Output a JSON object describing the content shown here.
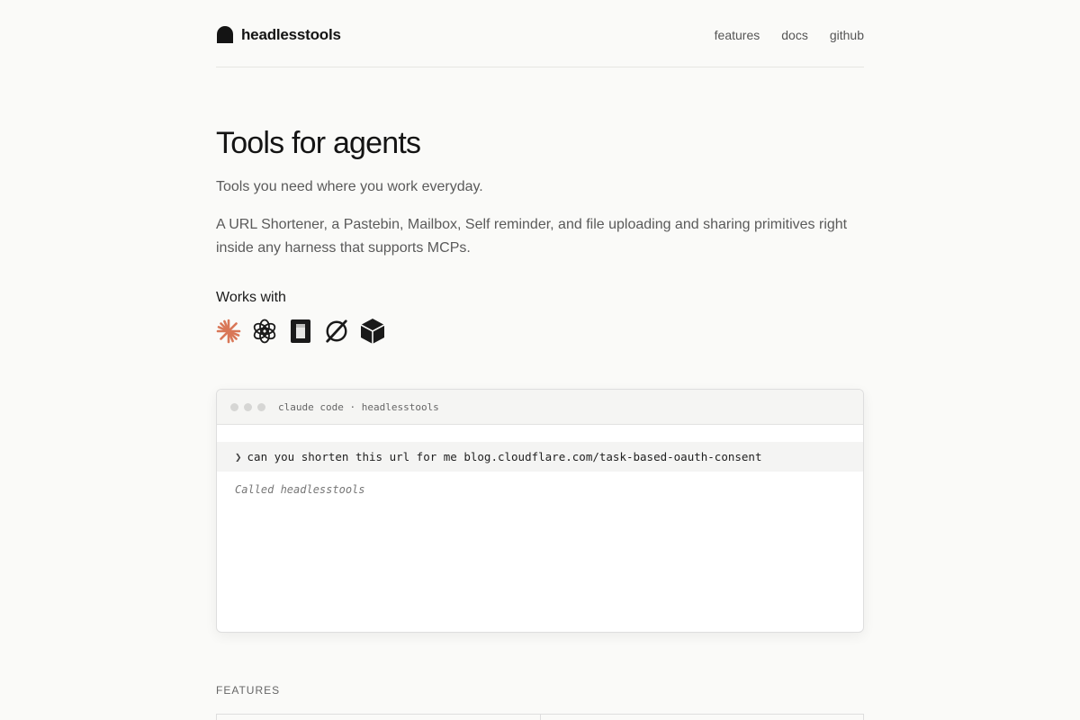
{
  "header": {
    "brand": "headlesstools",
    "nav": [
      "features",
      "docs",
      "github"
    ]
  },
  "hero": {
    "title": "Tools for agents",
    "subtitle": "Tools you need where you work everyday.",
    "description": "A URL Shortener, a Pastebin, Mailbox, Self reminder, and file uploading and sharing primitives right inside any harness that supports MCPs.",
    "works_with_label": "Works with",
    "works_with_icons": [
      "claude-icon",
      "openai-icon",
      "cursor-icon",
      "perplexity-icon",
      "box-icon"
    ]
  },
  "terminal": {
    "title": "claude code · headlesstools",
    "caret": "❯",
    "prompt": "can you shorten this url for me blog.cloudflare.com/task-based-oauth-consent",
    "status": "Called headlesstools"
  },
  "features": {
    "label": "FEATURES"
  },
  "colors": {
    "background": "#fafaf8",
    "accent": "#d97757",
    "text": "#141414",
    "muted": "#5a5a5a"
  }
}
